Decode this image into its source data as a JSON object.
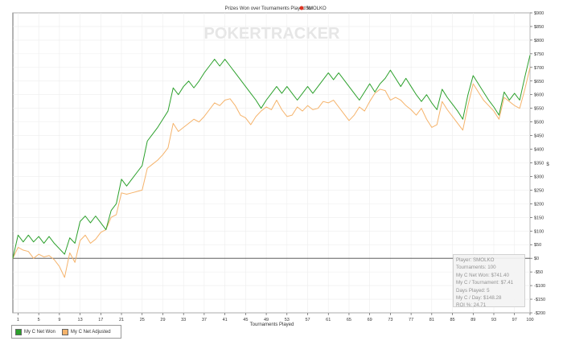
{
  "chart_data": {
    "type": "line",
    "title": "Prizes Won over Tournaments Played for",
    "player_name": "SMOLKO",
    "watermark": "POKERTRACKER",
    "xlabel": "Tournaments Played",
    "ylabel": "$",
    "xlim": [
      0,
      100
    ],
    "ylim": [
      -200,
      900
    ],
    "x_ticks": [
      1,
      5,
      9,
      13,
      17,
      21,
      25,
      29,
      33,
      37,
      41,
      45,
      49,
      53,
      57,
      61,
      65,
      69,
      73,
      77,
      81,
      85,
      89,
      93,
      97,
      100
    ],
    "y_ticks": [
      -200,
      -150,
      -100,
      -50,
      0,
      50,
      100,
      150,
      200,
      250,
      300,
      350,
      400,
      450,
      500,
      550,
      600,
      650,
      700,
      750,
      800,
      850,
      900
    ],
    "y_tick_labels": [
      "-$200",
      "-$150",
      "-$100",
      "-$50",
      "$0",
      "$50",
      "$100",
      "$150",
      "$200",
      "$250",
      "$300",
      "$350",
      "$400",
      "$450",
      "$500",
      "$550",
      "$600",
      "$650",
      "$700",
      "$750",
      "$800",
      "$850",
      "$900"
    ],
    "colors": {
      "net_won": "#2ca02c",
      "net_adjusted": "#f5b36b"
    },
    "x": [
      0,
      1,
      2,
      3,
      4,
      5,
      6,
      7,
      8,
      9,
      10,
      11,
      12,
      13,
      14,
      15,
      16,
      17,
      18,
      19,
      20,
      21,
      22,
      23,
      24,
      25,
      26,
      27,
      28,
      29,
      30,
      31,
      32,
      33,
      34,
      35,
      36,
      37,
      38,
      39,
      40,
      41,
      42,
      43,
      44,
      45,
      46,
      47,
      48,
      49,
      50,
      51,
      52,
      53,
      54,
      55,
      56,
      57,
      58,
      59,
      60,
      61,
      62,
      63,
      64,
      65,
      66,
      67,
      68,
      69,
      70,
      71,
      72,
      73,
      74,
      75,
      76,
      77,
      78,
      79,
      80,
      81,
      82,
      83,
      84,
      85,
      86,
      87,
      88,
      89,
      90,
      91,
      92,
      93,
      94,
      95,
      96,
      97,
      98,
      99,
      100
    ],
    "series": [
      {
        "name": "My C Net Won",
        "values": [
          0,
          85,
          60,
          85,
          60,
          80,
          55,
          80,
          55,
          35,
          15,
          75,
          55,
          135,
          155,
          130,
          155,
          130,
          105,
          175,
          200,
          290,
          265,
          290,
          315,
          340,
          430,
          455,
          480,
          510,
          540,
          625,
          600,
          630,
          650,
          625,
          650,
          680,
          705,
          730,
          705,
          730,
          705,
          680,
          655,
          630,
          605,
          580,
          550,
          580,
          605,
          630,
          605,
          630,
          605,
          580,
          605,
          630,
          605,
          630,
          655,
          680,
          655,
          680,
          655,
          630,
          605,
          580,
          610,
          640,
          610,
          640,
          660,
          690,
          660,
          630,
          660,
          630,
          600,
          575,
          600,
          570,
          545,
          620,
          590,
          565,
          540,
          510,
          600,
          670,
          640,
          610,
          580,
          555,
          525,
          610,
          580,
          605,
          580,
          665,
          745,
          770,
          745
        ]
      },
      {
        "name": "My C Net Adjusted",
        "values": [
          0,
          40,
          30,
          25,
          0,
          15,
          5,
          10,
          -5,
          -30,
          -70,
          20,
          -15,
          65,
          85,
          55,
          70,
          95,
          105,
          150,
          160,
          240,
          235,
          240,
          245,
          250,
          330,
          345,
          360,
          380,
          405,
          495,
          465,
          480,
          495,
          510,
          500,
          520,
          545,
          570,
          560,
          580,
          585,
          560,
          525,
          515,
          490,
          520,
          540,
          555,
          545,
          580,
          545,
          520,
          525,
          555,
          540,
          560,
          545,
          550,
          575,
          570,
          580,
          555,
          530,
          505,
          525,
          555,
          540,
          575,
          605,
          620,
          615,
          580,
          590,
          580,
          560,
          545,
          525,
          550,
          510,
          480,
          490,
          575,
          545,
          520,
          495,
          470,
          560,
          640,
          610,
          580,
          560,
          540,
          510,
          590,
          575,
          560,
          550,
          620,
          700,
          755,
          735
        ]
      }
    ],
    "legend": {
      "placement": "bottom-left",
      "entries": [
        "My C Net Won",
        "My C Net Adjusted"
      ]
    },
    "grid": true
  },
  "stats": {
    "player": "Player: SMOLKO",
    "tournaments": "Tournaments: 100",
    "net_won": "My C Net Won: $741.40",
    "per_tournament": "My C / Tournament: $7.41",
    "days_played": "Days Played: 5",
    "per_day": "My C / Day: $148.28",
    "roi": "ROI %: 24.71"
  }
}
